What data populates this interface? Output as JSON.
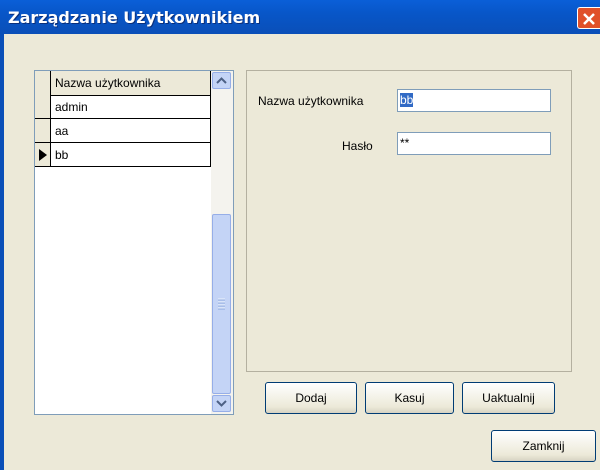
{
  "window": {
    "title": "Zarządzanie Użytkownikiem"
  },
  "grid": {
    "column_header": "Nazwa użytkownika",
    "rows": [
      {
        "name": "admin",
        "current": false
      },
      {
        "name": "aa",
        "current": false
      },
      {
        "name": "bb",
        "current": true
      }
    ]
  },
  "form": {
    "username_label": "Nazwa użytkownika",
    "username_value": "bb",
    "password_label": "Hasło",
    "password_value": "**"
  },
  "buttons": {
    "add": "Dodaj",
    "delete": "Kasuj",
    "update": "Uaktualnij",
    "close": "Zamknij"
  },
  "colors": {
    "titlebar": "#0a5fd8",
    "selection": "#316ac5",
    "close": "#e0502a"
  }
}
